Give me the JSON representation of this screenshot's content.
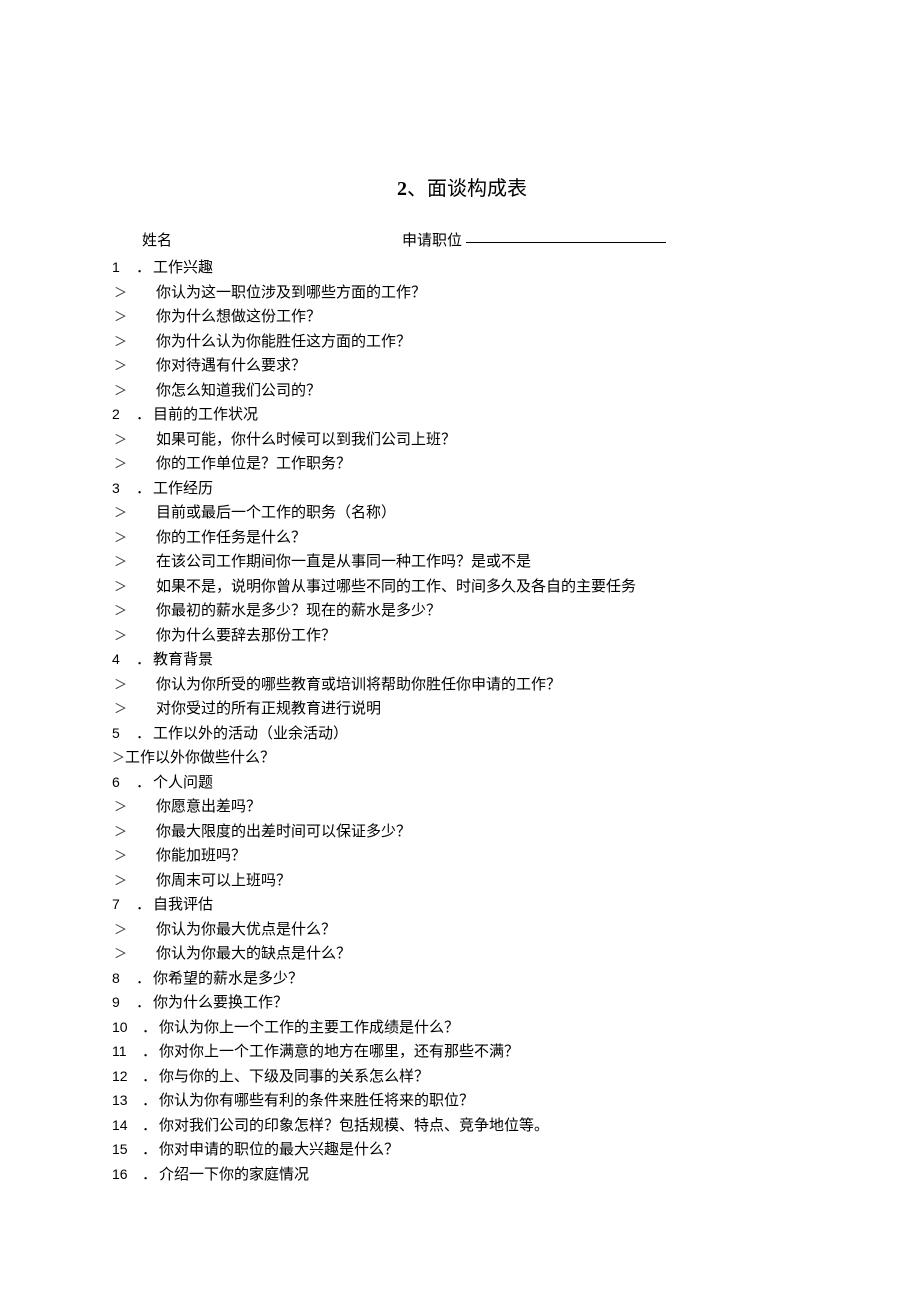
{
  "title_num": "2",
  "title_sep": "、",
  "title_text": "面谈构成表",
  "header": {
    "name_label": "姓名",
    "position_label": "申请职位"
  },
  "sections": [
    {
      "num": "1",
      "dot": "．",
      "label": "工作兴趣",
      "subs": [
        "你认为这一职位涉及到哪些方面的工作？",
        "你为什么想做这份工作？",
        "你为什么认为你能胜任这方面的工作？",
        "你对待遇有什么要求？",
        "你怎么知道我们公司的？"
      ]
    },
    {
      "num": "2",
      "dot": "．",
      "label": "目前的工作状况",
      "subs": [
        "如果可能，你什么时候可以到我们公司上班？",
        "你的工作单位是？工作职务？"
      ]
    },
    {
      "num": "3",
      "dot": "．",
      "label": "工作经历",
      "subs": [
        "目前或最后一个工作的职务（名称）",
        "你的工作任务是什么？",
        "在该公司工作期间你一直是从事同一种工作吗？是或不是",
        "如果不是，说明你曾从事过哪些不同的工作、时间多久及各自的主要任务",
        "你最初的薪水是多少？现在的薪水是多少？",
        "你为什么要辞去那份工作？"
      ]
    },
    {
      "num": "4",
      "dot": "．",
      "label": "教育背景",
      "subs": [
        "你认为你所受的哪些教育或培训将帮助你胜任你申请的工作？",
        "对你受过的所有正规教育进行说明"
      ]
    },
    {
      "num": "5",
      "dot": "．",
      "label": "工作以外的活动（业余活动）",
      "inline_sub": "工作以外你做些什么？"
    },
    {
      "num": "6",
      "dot": "．",
      "label": "个人问题",
      "subs": [
        "你愿意出差吗？",
        "你最大限度的出差时间可以保证多少？",
        "你能加班吗？",
        "你周末可以上班吗？"
      ]
    },
    {
      "num": "7",
      "dot": "．",
      "label": "自我评估",
      "subs": [
        "你认为你最大优点是什么？",
        "你认为你最大的缺点是什么？"
      ]
    },
    {
      "num": "8",
      "dot": "．",
      "label": "你希望的薪水是多少？"
    },
    {
      "num": "9",
      "dot": "．",
      "label": "你为什么要换工作？"
    },
    {
      "num": "10",
      "dot": "．",
      "label": "你认为你上一个工作的主要工作成绩是什么？"
    },
    {
      "num": "11",
      "dot": "．",
      "label": "你对你上一个工作满意的地方在哪里，还有那些不满？"
    },
    {
      "num": "12",
      "dot": "．",
      "label": "你与你的上、下级及同事的关系怎么样？"
    },
    {
      "num": "13",
      "dot": "．",
      "label": "你认为你有哪些有利的条件来胜任将来的职位？"
    },
    {
      "num": "14",
      "dot": "．",
      "label": "你对我们公司的印象怎样？包括规模、特点、竞争地位等。"
    },
    {
      "num": "15",
      "dot": "．",
      "label": "你对申请的职位的最大兴趣是什么？"
    },
    {
      "num": "16",
      "dot": "．",
      "label": "介绍一下你的家庭情况"
    }
  ],
  "arrow": "＞"
}
